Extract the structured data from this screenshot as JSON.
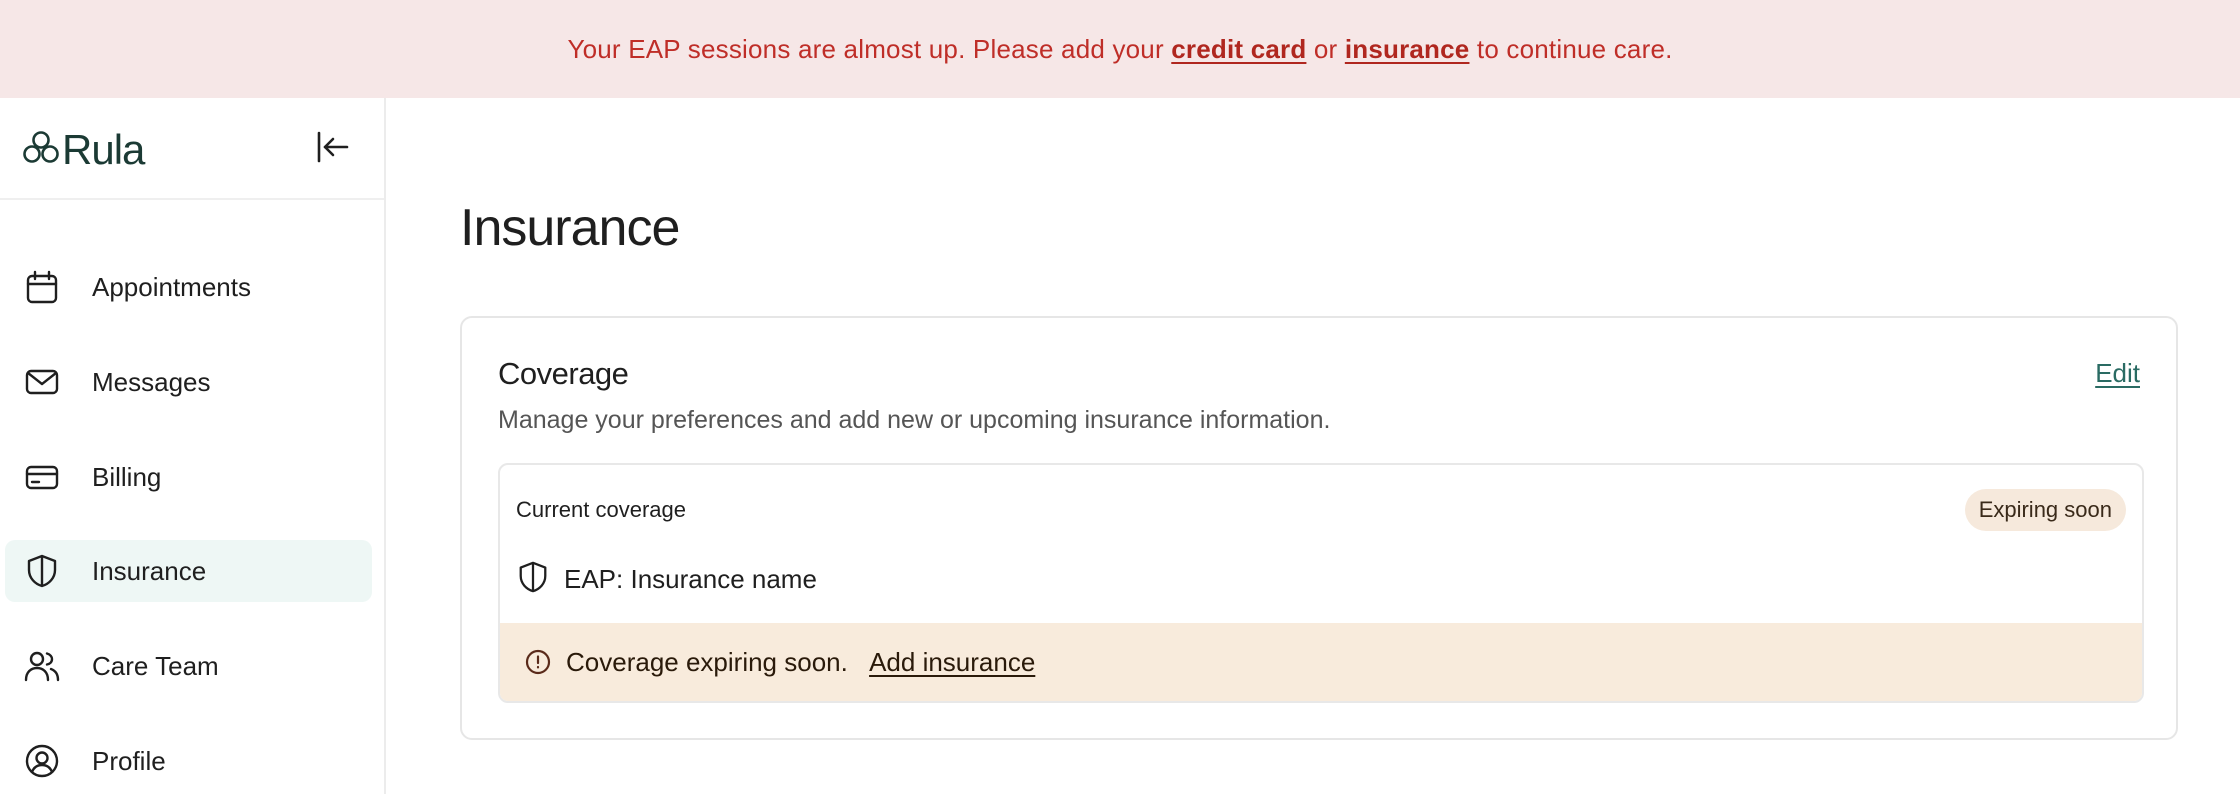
{
  "banner": {
    "text_before": "Your EAP sessions are almost up. Please add your",
    "link_credit_card": "credit card",
    "text_or": "or",
    "link_insurance": "insurance",
    "text_after": "to continue care."
  },
  "app": {
    "logo_text": "Rula"
  },
  "sidebar": {
    "collapse_icon": "collapse-left-icon",
    "items": [
      {
        "label": "Appointments",
        "icon": "calendar-icon"
      },
      {
        "label": "Messages",
        "icon": "mail-icon"
      },
      {
        "label": "Billing",
        "icon": "credit-card-icon"
      },
      {
        "label": "Insurance",
        "icon": "shield-icon",
        "active": true
      },
      {
        "label": "Care Team",
        "icon": "users-icon"
      },
      {
        "label": "Profile",
        "icon": "user-circle-icon"
      }
    ]
  },
  "main": {
    "page_title": "Insurance",
    "card": {
      "title": "Coverage",
      "edit_label": "Edit",
      "description": "Manage your preferences and add new or upcoming insurance information.",
      "current": {
        "label": "Current coverage",
        "badge": "Expiring soon",
        "insurance_name": "EAP: Insurance name",
        "warning_text": "Coverage expiring soon.",
        "warning_link": "Add insurance"
      }
    }
  },
  "colors": {
    "banner_bg": "#f6e7e7",
    "banner_text": "#bf2e28",
    "brand": "#1b3a34",
    "active_nav_bg": "#eef7f5",
    "warning_bg": "#f8ebdc",
    "badge_bg": "#f6e9dc",
    "edit_link": "#2a6b63"
  }
}
